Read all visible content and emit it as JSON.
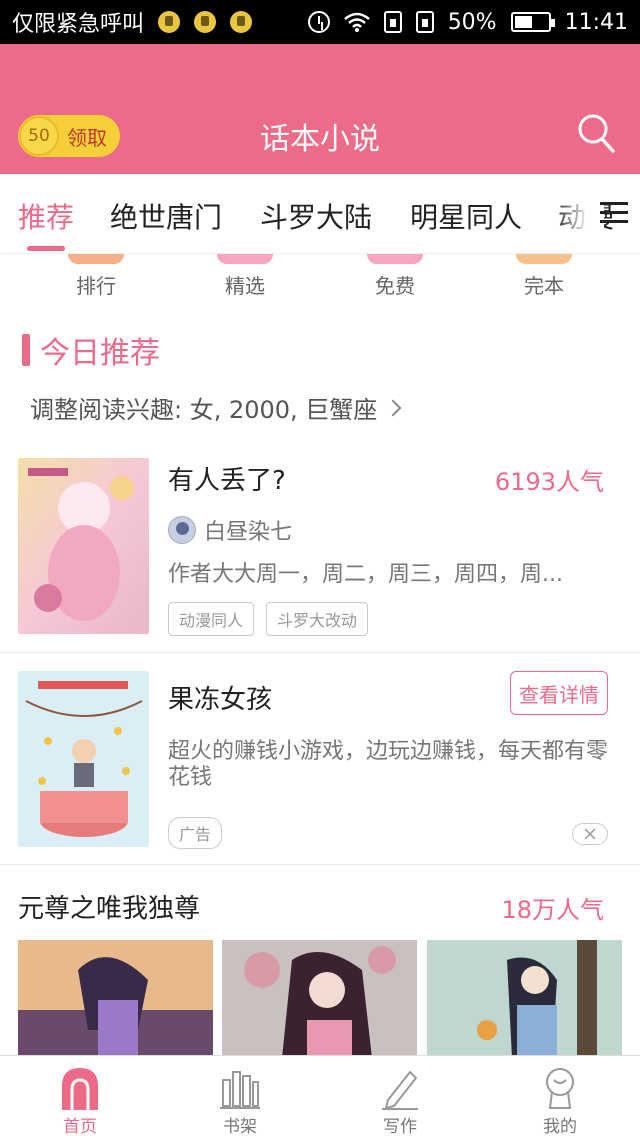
{
  "status_bar": {
    "left_text": "仅限紧急呼叫",
    "battery": "50%",
    "time": "11:41",
    "icons": [
      "notification-icon",
      "alarm-icon",
      "wifi-icon",
      "sim-icon",
      "battery-icon"
    ]
  },
  "header": {
    "coin_count": "50",
    "coin_label": "领取",
    "title": "话本小说",
    "search_icon": "search-icon"
  },
  "tabs": [
    {
      "label": "推荐",
      "active": true
    },
    {
      "label": "绝世唐门"
    },
    {
      "label": "斗罗大陆"
    },
    {
      "label": "明星同人"
    },
    {
      "label": "动漫"
    }
  ],
  "categories": [
    {
      "label": "排行",
      "color": "#f5b08a"
    },
    {
      "label": "精选",
      "color": "#f7a6c0"
    },
    {
      "label": "免费",
      "color": "#f7a6c0"
    },
    {
      "label": "完本",
      "color": "#f5c08a"
    }
  ],
  "today": {
    "title": "今日推荐",
    "interest": "调整阅读兴趣: 女, 2000, 巨蟹座"
  },
  "book1": {
    "title": "有人丢了?",
    "popularity": "6193人气",
    "author": "白昼染七",
    "desc": "作者大大周一，周二，周三，周四，周...",
    "tags": [
      "动漫同人",
      "斗罗大改动"
    ]
  },
  "ad": {
    "title": "果冻女孩",
    "button": "查看详情",
    "desc": "超火的赚钱小游戏，边玩边赚钱，每天都有零花钱",
    "tag": "广告"
  },
  "book3": {
    "title": "元尊之唯我独尊",
    "popularity": "18万人气"
  },
  "bottom_nav": [
    {
      "label": "首页",
      "icon": "home-icon",
      "active": true
    },
    {
      "label": "书架",
      "icon": "bookshelf-icon"
    },
    {
      "label": "写作",
      "icon": "pen-icon"
    },
    {
      "label": "我的",
      "icon": "profile-icon"
    }
  ],
  "colors": {
    "accent": "#ec6b89",
    "coin": "#f5cf3a"
  }
}
